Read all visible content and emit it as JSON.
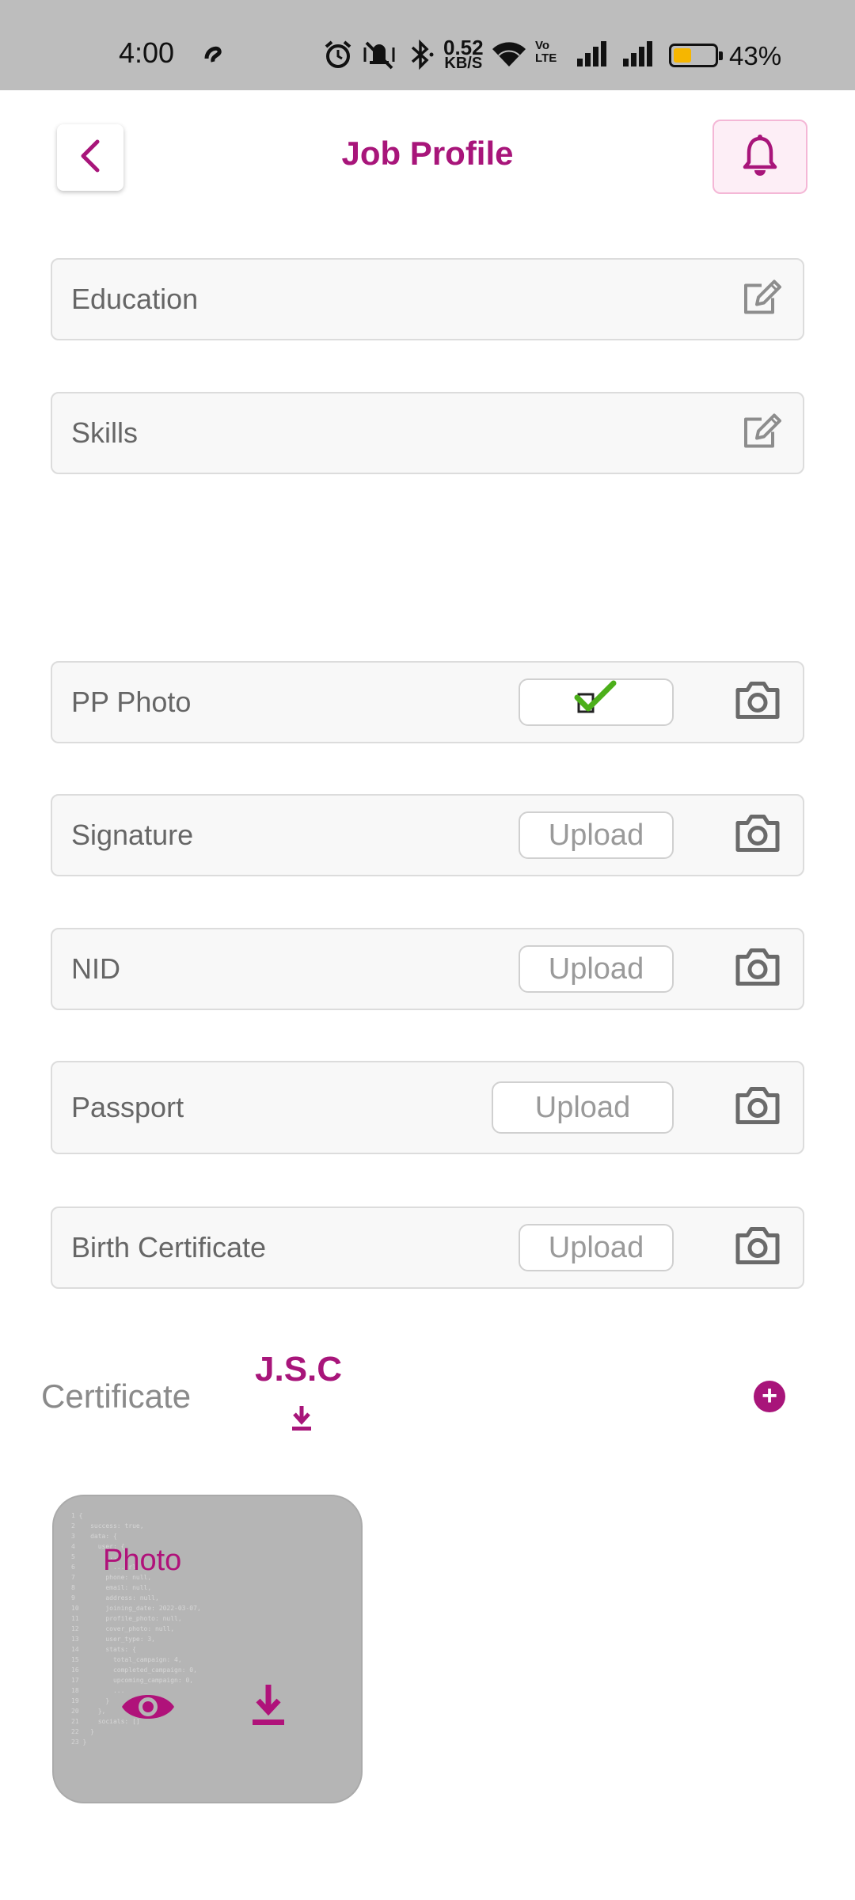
{
  "status_bar": {
    "time": "4:00",
    "network_speed_value": "0.52",
    "network_speed_unit": "KB/S",
    "volte_label": "Vo LTE",
    "battery_percent": "43%",
    "battery_level": 0.43,
    "battery_color": "#f6b600"
  },
  "header": {
    "title": "Job Profile",
    "back_icon": "chevron-left-icon",
    "notification_icon": "bell-icon"
  },
  "profile_fields": [
    {
      "label": "Education",
      "action_icon": "edit-icon"
    },
    {
      "label": "Skills",
      "action_icon": "edit-icon"
    }
  ],
  "documents": [
    {
      "label": "PP Photo",
      "status": "uploaded",
      "status_icon": "checkmark-icon"
    },
    {
      "label": "Signature",
      "button": "Upload"
    },
    {
      "label": "NID",
      "button": "Upload"
    },
    {
      "label": "Passport",
      "button": "Upload"
    },
    {
      "label": "Birth Certificate",
      "button": "Upload"
    }
  ],
  "certificate": {
    "label": "Certificate",
    "selected": "J.S.C",
    "add_icon": "plus-circle-icon"
  },
  "photo_card": {
    "title": "Photo",
    "code_preview": "1 {\n2    success: true,\n3    data: {\n4      user: {\n5        ...\n6          ...url\n7        phone: null,\n8        email: null,\n9        address: null,\n10       joining_date: 2022-03-07,\n11       profile_photo: null,\n12       cover_photo: null,\n13       user_type: 3,\n14       stats: {\n15         total_campaign: 4,\n16         completed_campaign: 0,\n17         upcoming_campaign: 0,\n18         ...\n19       }\n20     },\n21     socials: []\n22   }\n23 }"
  },
  "colors": {
    "brand": "#a8157a",
    "field_bg": "#f8f8f8",
    "status_bar_bg": "#bdbdbd",
    "check_green": "#4caf1a"
  }
}
